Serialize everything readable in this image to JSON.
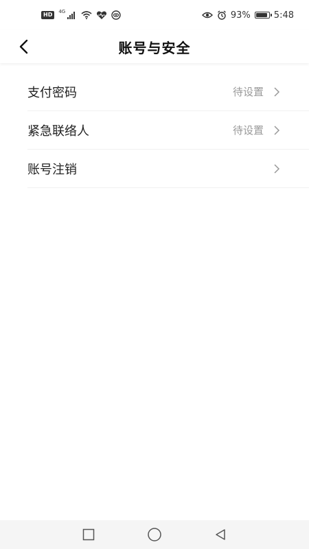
{
  "status_bar": {
    "hd": "HD",
    "network": "4G",
    "battery_percent": "93%",
    "battery_level": 0.93,
    "time": "5:48"
  },
  "header": {
    "title": "账号与安全",
    "back_icon": "chevron-left-icon"
  },
  "settings": {
    "items": [
      {
        "label": "支付密码",
        "status": "待设置"
      },
      {
        "label": "紧急联络人",
        "status": "待设置"
      },
      {
        "label": "账号注销",
        "status": ""
      }
    ]
  },
  "nav_bar": {
    "icons": [
      "square-icon",
      "circle-icon",
      "triangle-back-icon"
    ]
  }
}
